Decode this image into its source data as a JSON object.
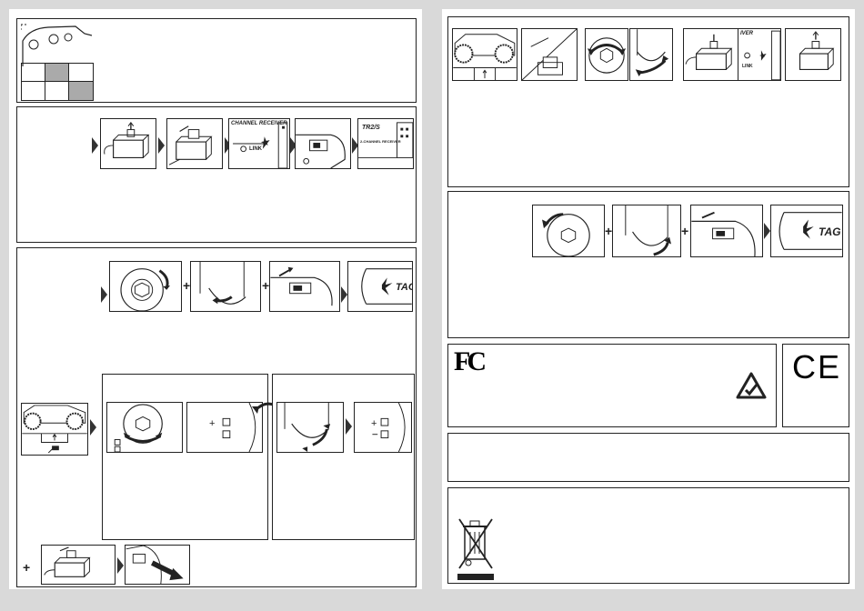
{
  "colors": {
    "page_bg": "#d9d9d9",
    "paper": "#ffffff",
    "ink": "#222222",
    "grid_fill": "#aaaaaa"
  },
  "labels": {
    "channel_receiver": "CHANNEL RECEIVER",
    "link": "LINK",
    "receiver_short": "IVER",
    "brand_model": "TR2/S",
    "hs_receiver": "2-CHANNEL RECEIVER",
    "tag": "TAG",
    "plus": "+",
    "fcc_mark": "FC",
    "ce_mark": "CE"
  },
  "icons": [
    "fcc-logo",
    "ce-mark",
    "rcm-mark",
    "weee-crossed-bin-icon",
    "flash-icon",
    "truck-icon",
    "receiver-icon",
    "steering-wheel-icon",
    "trigger-icon",
    "switch-icon"
  ]
}
